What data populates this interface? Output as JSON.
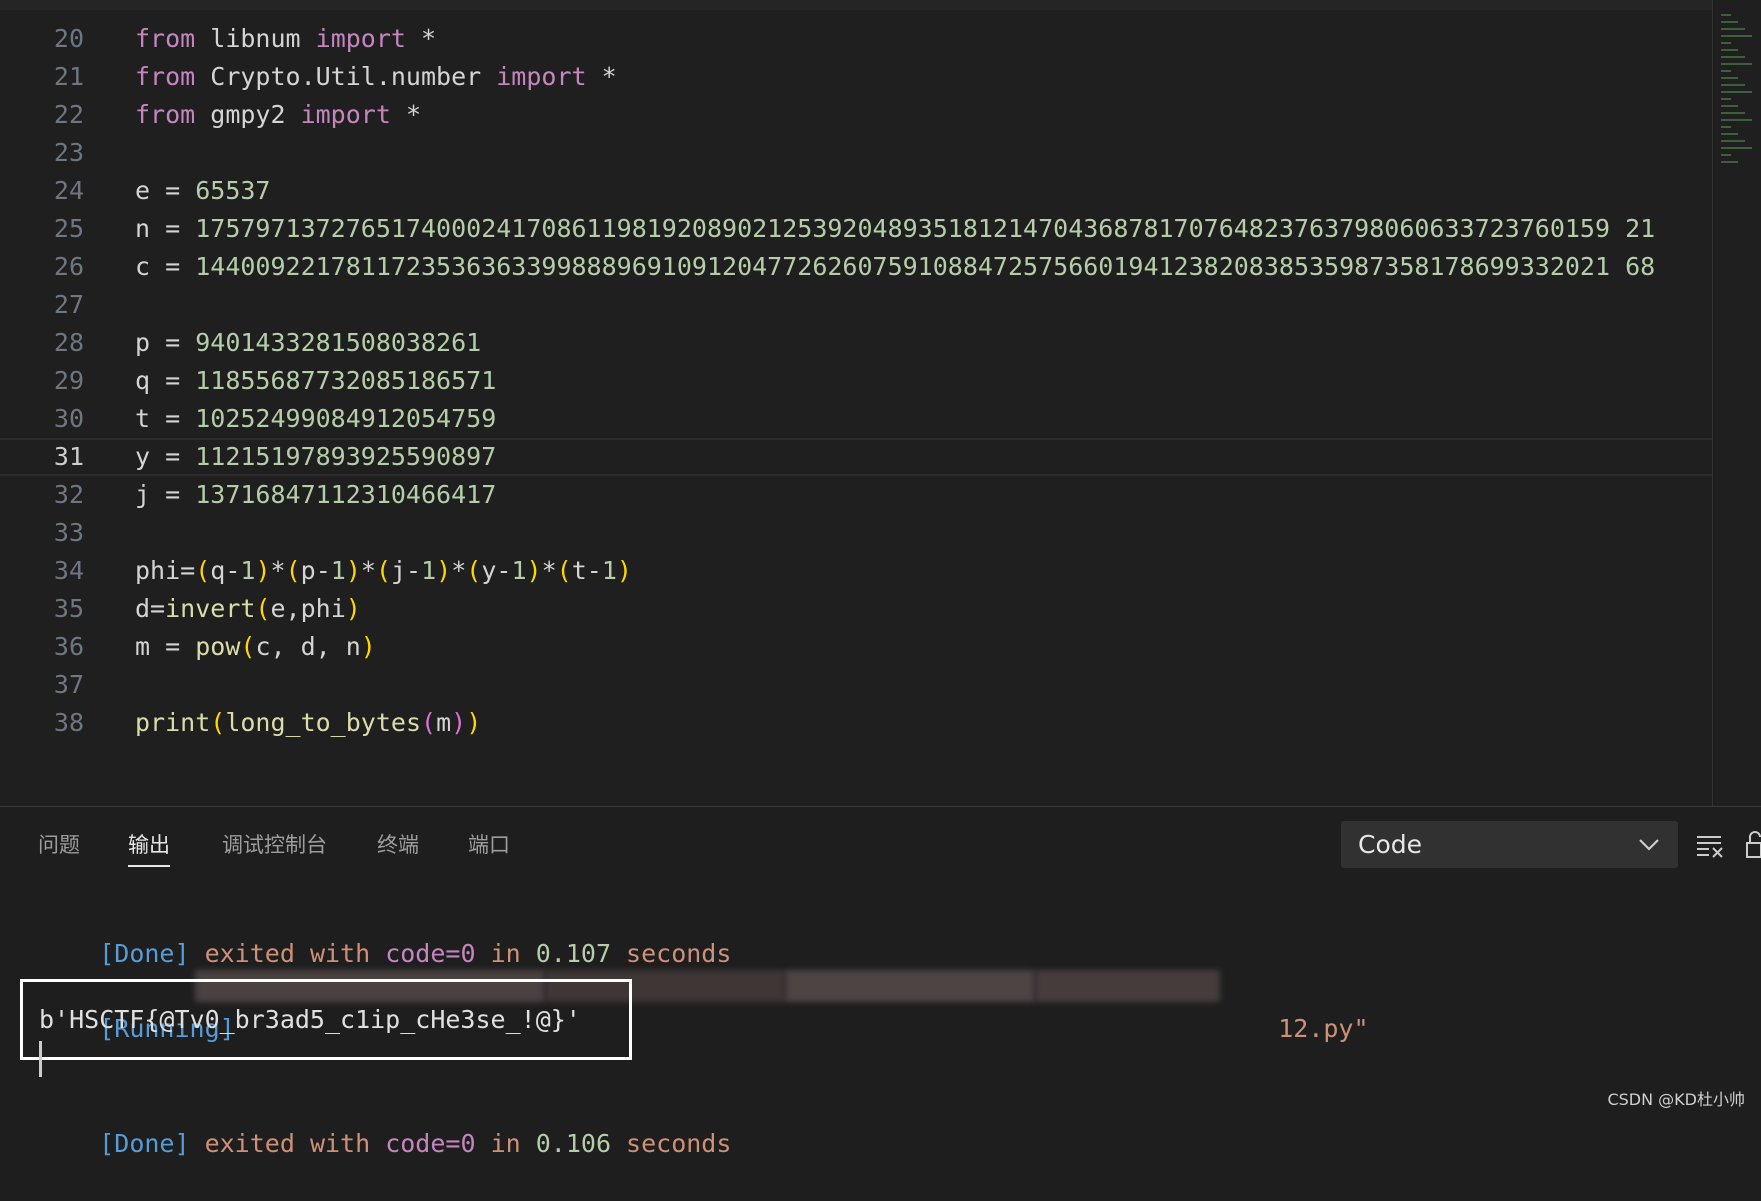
{
  "editor": {
    "current_line": "31",
    "lines": [
      {
        "n": "20",
        "tokens": [
          [
            "kw",
            "from"
          ],
          [
            "id",
            " libnum "
          ],
          [
            "kw",
            "import"
          ],
          [
            "id",
            " *"
          ]
        ]
      },
      {
        "n": "21",
        "tokens": [
          [
            "kw",
            "from"
          ],
          [
            "id",
            " Crypto.Util.number "
          ],
          [
            "kw",
            "import"
          ],
          [
            "id",
            " *"
          ]
        ]
      },
      {
        "n": "22",
        "tokens": [
          [
            "kw",
            "from"
          ],
          [
            "id",
            " gmpy2 "
          ],
          [
            "kw",
            "import"
          ],
          [
            "id",
            " *"
          ]
        ]
      },
      {
        "n": "23",
        "tokens": []
      },
      {
        "n": "24",
        "tokens": [
          [
            "id",
            "e = "
          ],
          [
            "num",
            "65537"
          ]
        ]
      },
      {
        "n": "25",
        "tokens": [
          [
            "id",
            "n = "
          ],
          [
            "num",
            "1757971372765174000241708611981920890212539204893518121470436878170764823763798060633723760159 21"
          ]
        ]
      },
      {
        "n": "26",
        "tokens": [
          [
            "id",
            "c = "
          ],
          [
            "num",
            "1440092217811723536363399888969109120477262607591088472575660194123820838535987358178699332021 68"
          ]
        ]
      },
      {
        "n": "27",
        "tokens": []
      },
      {
        "n": "28",
        "tokens": [
          [
            "id",
            "p = "
          ],
          [
            "num",
            "9401433281508038261"
          ]
        ]
      },
      {
        "n": "29",
        "tokens": [
          [
            "id",
            "q = "
          ],
          [
            "num",
            "11855687732085186571"
          ]
        ]
      },
      {
        "n": "30",
        "tokens": [
          [
            "id",
            "t = "
          ],
          [
            "num",
            "10252499084912054759"
          ]
        ]
      },
      {
        "n": "31",
        "tokens": [
          [
            "id",
            "y = "
          ],
          [
            "num",
            "11215197893925590897"
          ]
        ]
      },
      {
        "n": "32",
        "tokens": [
          [
            "id",
            "j = "
          ],
          [
            "num",
            "13716847112310466417"
          ]
        ]
      },
      {
        "n": "33",
        "tokens": []
      },
      {
        "n": "34",
        "tokens": [
          [
            "id",
            "phi="
          ],
          [
            "br1",
            "("
          ],
          [
            "id",
            "q-"
          ],
          [
            "num",
            "1"
          ],
          [
            "br1",
            ")"
          ],
          [
            "id",
            "*"
          ],
          [
            "br1",
            "("
          ],
          [
            "id",
            "p-"
          ],
          [
            "num",
            "1"
          ],
          [
            "br1",
            ")"
          ],
          [
            "id",
            "*"
          ],
          [
            "br1",
            "("
          ],
          [
            "id",
            "j-"
          ],
          [
            "num",
            "1"
          ],
          [
            "br1",
            ")"
          ],
          [
            "id",
            "*"
          ],
          [
            "br1",
            "("
          ],
          [
            "id",
            "y-"
          ],
          [
            "num",
            "1"
          ],
          [
            "br1",
            ")"
          ],
          [
            "id",
            "*"
          ],
          [
            "br1",
            "("
          ],
          [
            "id",
            "t-"
          ],
          [
            "num",
            "1"
          ],
          [
            "br1",
            ")"
          ]
        ]
      },
      {
        "n": "35",
        "tokens": [
          [
            "id",
            "d="
          ],
          [
            "fn",
            "invert"
          ],
          [
            "br1",
            "("
          ],
          [
            "id",
            "e,phi"
          ],
          [
            "br1",
            ")"
          ]
        ]
      },
      {
        "n": "36",
        "tokens": [
          [
            "id",
            "m = "
          ],
          [
            "fn",
            "pow"
          ],
          [
            "br1",
            "("
          ],
          [
            "id",
            "c, d, n"
          ],
          [
            "br1",
            ")"
          ]
        ]
      },
      {
        "n": "37",
        "tokens": []
      },
      {
        "n": "38",
        "tokens": [
          [
            "fn",
            "print"
          ],
          [
            "br1",
            "("
          ],
          [
            "fn",
            "long_to_bytes"
          ],
          [
            "br2",
            "("
          ],
          [
            "id",
            "m"
          ],
          [
            "br2",
            ")"
          ],
          [
            "br1",
            ")"
          ]
        ]
      }
    ]
  },
  "panel": {
    "tabs": [
      "问题",
      "输出",
      "调试控制台",
      "终端",
      "端口"
    ],
    "active_tab": "输出",
    "channel_select": "Code",
    "output": {
      "done1": {
        "tag": "[Done]",
        "text1": " exited with ",
        "code": "code=0",
        "in": " in ",
        "time": "0.107",
        "sec": " seconds"
      },
      "running": {
        "tag": "[Running]",
        "tail": "12.py\""
      },
      "result": "b'HSCTF{@Tv0_br3ad5_c1ip_cHe3se_!@}'",
      "done2": {
        "tag": "[Done]",
        "text1": " exited with ",
        "code": "code=0",
        "in": " in ",
        "time": "0.106",
        "sec": " seconds"
      }
    }
  },
  "watermark": "CSDN @KD杜小帅",
  "colors": {
    "keyword": "#c586c0",
    "number": "#b5cea8",
    "function": "#dcdcaa",
    "bracket": "#ffd700",
    "output_tag": "#569cd6",
    "output_text": "#ce9178"
  }
}
